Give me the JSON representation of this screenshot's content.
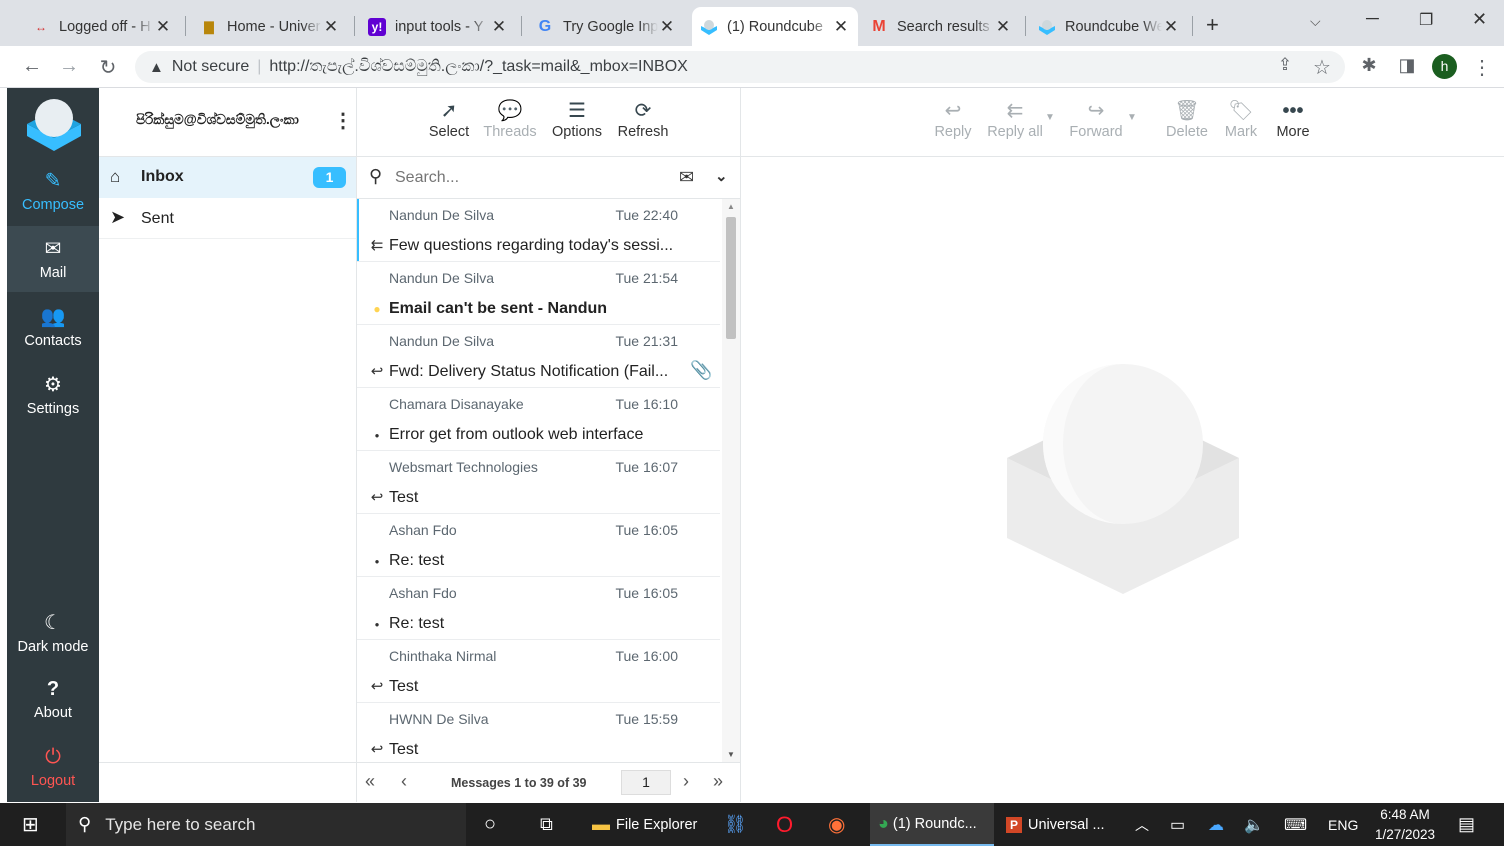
{
  "browser": {
    "tabs": [
      {
        "title": "Logged off - H",
        "icon": "vmware-icon"
      },
      {
        "title": "Home - Univer",
        "icon": "university-icon"
      },
      {
        "title": "input tools - Y",
        "icon": "yahoo-icon"
      },
      {
        "title": "Try Google Inp",
        "icon": "google-icon"
      },
      {
        "title": "(1) Roundcube",
        "icon": "roundcube-icon",
        "active": true
      },
      {
        "title": "Search results",
        "icon": "gmail-icon"
      },
      {
        "title": "Roundcube We",
        "icon": "roundcube-icon"
      }
    ],
    "security": "Not secure",
    "url": "http://තැපැල්.විශ්වසම්මුති.ලංකා/?_task=mail&_mbox=INBOX",
    "profile_initial": "h"
  },
  "rail": {
    "compose": "Compose",
    "mail": "Mail",
    "contacts": "Contacts",
    "settings": "Settings",
    "dark_mode": "Dark mode",
    "about": "About",
    "logout": "Logout"
  },
  "account": "පිරික්සුම@විශ්වසම්මුති.ලංකා",
  "folders": [
    {
      "name": "Inbox",
      "count": "1",
      "icon": "inbox-icon"
    },
    {
      "name": "Sent",
      "count": "",
      "icon": "paper-plane-icon"
    }
  ],
  "list_toolbar": {
    "select": "Select",
    "threads": "Threads",
    "options": "Options",
    "refresh": "Refresh"
  },
  "search": {
    "placeholder": "Search..."
  },
  "messages": [
    {
      "from": "Nandun De Silva",
      "date": "Tue 22:40",
      "subject": "Few questions regarding today's sessi...",
      "status": "replied-all"
    },
    {
      "from": "Nandun De Silva",
      "date": "Tue 21:54",
      "subject": "Email can't be sent - Nandun",
      "status": "unread"
    },
    {
      "from": "Nandun De Silva",
      "date": "Tue 21:31",
      "subject": "Fwd: Delivery Status Notification (Fail...",
      "status": "replied",
      "attachment": true
    },
    {
      "from": "Chamara Disanayake",
      "date": "Tue 16:10",
      "subject": "Error get from outlook web interface",
      "status": "read"
    },
    {
      "from": "Websmart Technologies",
      "date": "Tue 16:07",
      "subject": "Test",
      "status": "replied"
    },
    {
      "from": "Ashan Fdo",
      "date": "Tue 16:05",
      "subject": "Re: test",
      "status": "read"
    },
    {
      "from": "Ashan Fdo",
      "date": "Tue 16:05",
      "subject": "Re: test",
      "status": "read"
    },
    {
      "from": "Chinthaka Nirmal",
      "date": "Tue 16:00",
      "subject": "Test",
      "status": "replied"
    },
    {
      "from": "HWNN De Silva",
      "date": "Tue 15:59",
      "subject": "Test",
      "status": "replied"
    }
  ],
  "pagination": {
    "text": "Messages 1 to 39 of 39",
    "page": "1"
  },
  "message_toolbar": {
    "reply": "Reply",
    "reply_all": "Reply all",
    "forward": "Forward",
    "delete": "Delete",
    "mark": "Mark",
    "more": "More"
  },
  "taskbar": {
    "search_placeholder": "Type here to search",
    "file_explorer": "File Explorer",
    "chrome_task": "(1) Roundc...",
    "ppt_task": "Universal ...",
    "lang": "ENG",
    "time": "6:48 AM",
    "date": "1/27/2023"
  },
  "colors": {
    "accent": "#37beff",
    "rail": "#2f3a3f",
    "selected": "#e5f3fb",
    "unread_dot": "#ffd452",
    "logout": "#ff5552"
  }
}
